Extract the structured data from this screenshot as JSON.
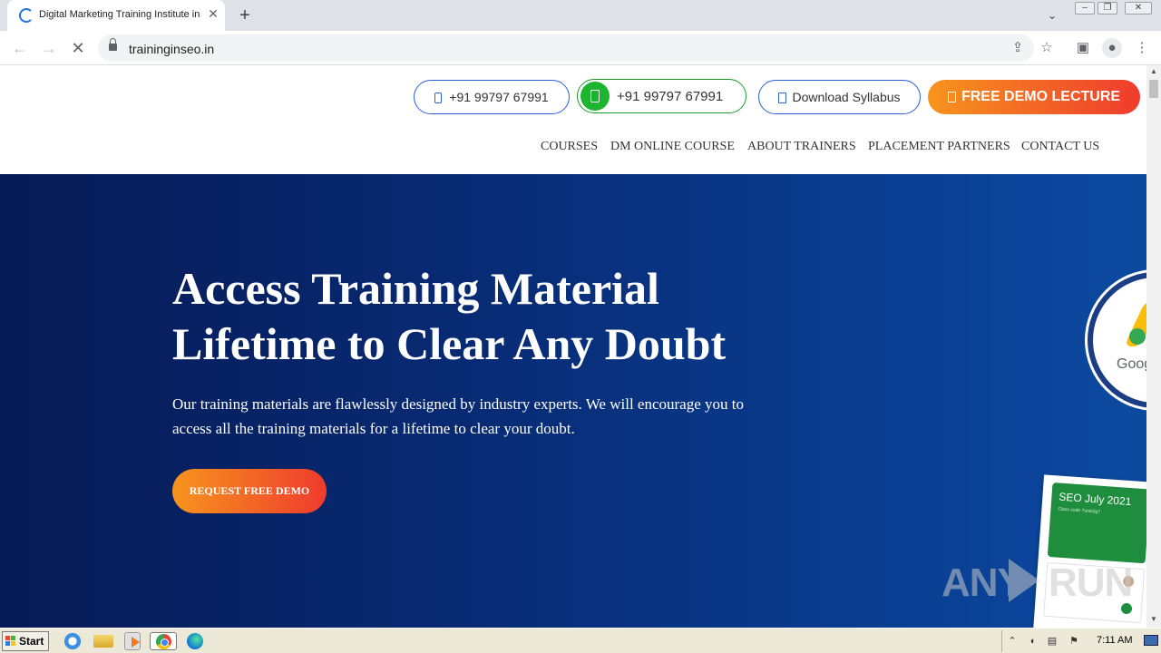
{
  "browser": {
    "tab_title": "Digital Marketing Training Institute in",
    "url": "traininginseo.in"
  },
  "header": {
    "call_number": "+91 99797 67991",
    "whatsapp_number": "+91 99797 67991",
    "download_label": "Download Syllabus",
    "demo_label": "FREE DEMO LECTURE",
    "nav": [
      "COURSES",
      "DM ONLINE COURSE",
      "ABOUT TRAINERS",
      "PLACEMENT PARTNERS",
      "CONTACT US"
    ]
  },
  "hero": {
    "title_line1": "Access Training Material",
    "title_line2": "Lifetime to Clear Any Doubt",
    "subtitle": "Our training materials are flawlessly designed by industry experts. We will encourage you to access all the training materials for a lifetime to clear your doubt.",
    "cta_label": "REQUEST FREE DEMO",
    "ads_word": "Goog",
    "classroom_title": "SEO July 2021",
    "classroom_code": "Class code  7umk2g7"
  },
  "watermark": {
    "left": "ANY",
    "right": "RUN"
  },
  "taskbar": {
    "start_label": "Start",
    "clock": "7:11 AM"
  },
  "colors": {
    "accent_orange": "#f7941d",
    "accent_red": "#ef3b2d",
    "hero_blue": "#082a73",
    "whatsapp_green": "#1db52f"
  }
}
